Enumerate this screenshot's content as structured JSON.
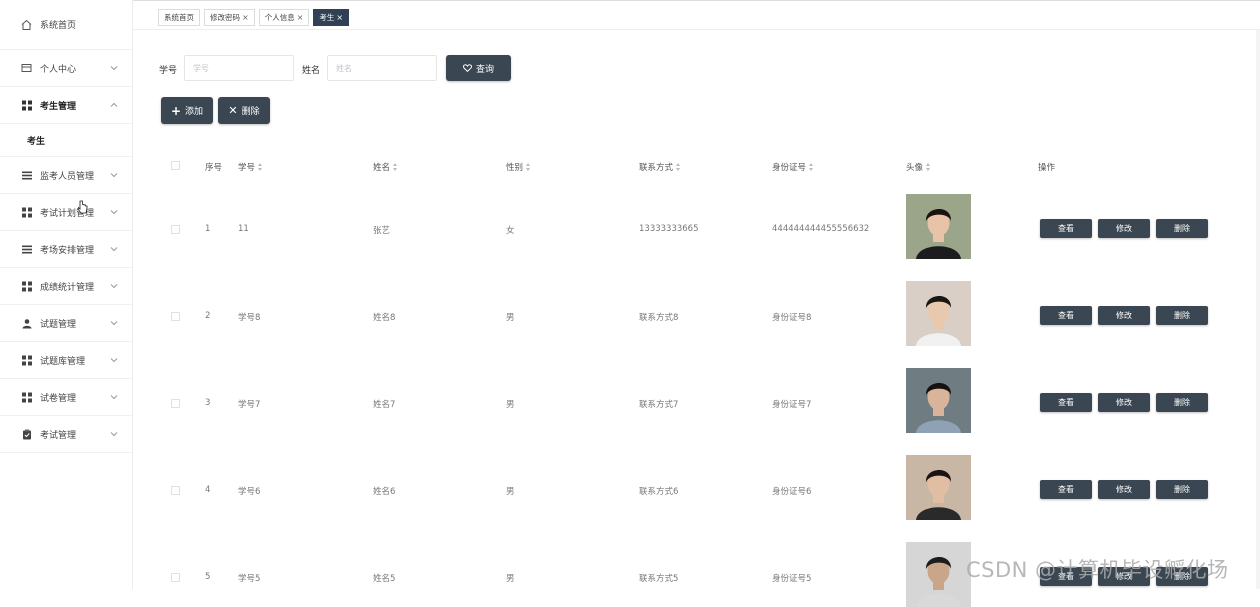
{
  "sidebar": {
    "items": [
      {
        "label": "系统首页",
        "icon": "home-icon",
        "has_children": false
      },
      {
        "label": "个人中心",
        "icon": "id-card-icon",
        "has_children": true
      },
      {
        "label": "考生管理",
        "icon": "grid-icon",
        "has_children": true,
        "expanded": true,
        "bold": true,
        "children": [
          {
            "label": "考生"
          }
        ]
      },
      {
        "label": "监考人员管理",
        "icon": "list-icon",
        "has_children": true
      },
      {
        "label": "考试计划管理",
        "icon": "grid-icon",
        "has_children": true
      },
      {
        "label": "考场安排管理",
        "icon": "list-icon",
        "has_children": true
      },
      {
        "label": "成绩统计管理",
        "icon": "grid-icon",
        "has_children": true
      },
      {
        "label": "试题管理",
        "icon": "user-icon",
        "has_children": true
      },
      {
        "label": "试题库管理",
        "icon": "grid-icon",
        "has_children": true
      },
      {
        "label": "试卷管理",
        "icon": "grid-icon",
        "has_children": true
      },
      {
        "label": "考试管理",
        "icon": "clipboard-icon",
        "has_children": true
      }
    ]
  },
  "tags": [
    {
      "label": "系统首页",
      "closable": false,
      "active": false
    },
    {
      "label": "修改密码",
      "closable": true,
      "active": false
    },
    {
      "label": "个人信息",
      "closable": true,
      "active": false
    },
    {
      "label": "考生",
      "closable": true,
      "active": true
    }
  ],
  "search": {
    "student_no_label": "学号",
    "student_no_placeholder": "学号",
    "name_label": "姓名",
    "name_placeholder": "姓名",
    "query_button": "查询"
  },
  "toolbar": {
    "add_button": "添加",
    "delete_button": "删除"
  },
  "table": {
    "columns": [
      "序号",
      "学号",
      "姓名",
      "性别",
      "联系方式",
      "身份证号",
      "头像",
      "操作"
    ],
    "rows": [
      {
        "index": "1",
        "student_no": "11",
        "name": "张艺",
        "gender": "女",
        "contact": "13333333665",
        "id_no": "444444444455556632",
        "avatar": "female-portrait"
      },
      {
        "index": "2",
        "student_no": "学号8",
        "name": "姓名8",
        "gender": "男",
        "contact": "联系方式8",
        "id_no": "身份证号8",
        "avatar": "male-portrait-1"
      },
      {
        "index": "3",
        "student_no": "学号7",
        "name": "姓名7",
        "gender": "男",
        "contact": "联系方式7",
        "id_no": "身份证号7",
        "avatar": "male-portrait-2"
      },
      {
        "index": "4",
        "student_no": "学号6",
        "name": "姓名6",
        "gender": "男",
        "contact": "联系方式6",
        "id_no": "身份证号6",
        "avatar": "male-portrait-3"
      },
      {
        "index": "5",
        "student_no": "学号5",
        "name": "姓名5",
        "gender": "男",
        "contact": "联系方式5",
        "id_no": "身份证号5",
        "avatar": "male-portrait-4"
      }
    ],
    "actions": {
      "view": "查看",
      "edit": "修改",
      "delete": "删除"
    }
  },
  "watermark": "CSDN @计算机毕设孵化场",
  "colors": {
    "button_dark": "#3a4651",
    "active_tag": "#304156"
  }
}
